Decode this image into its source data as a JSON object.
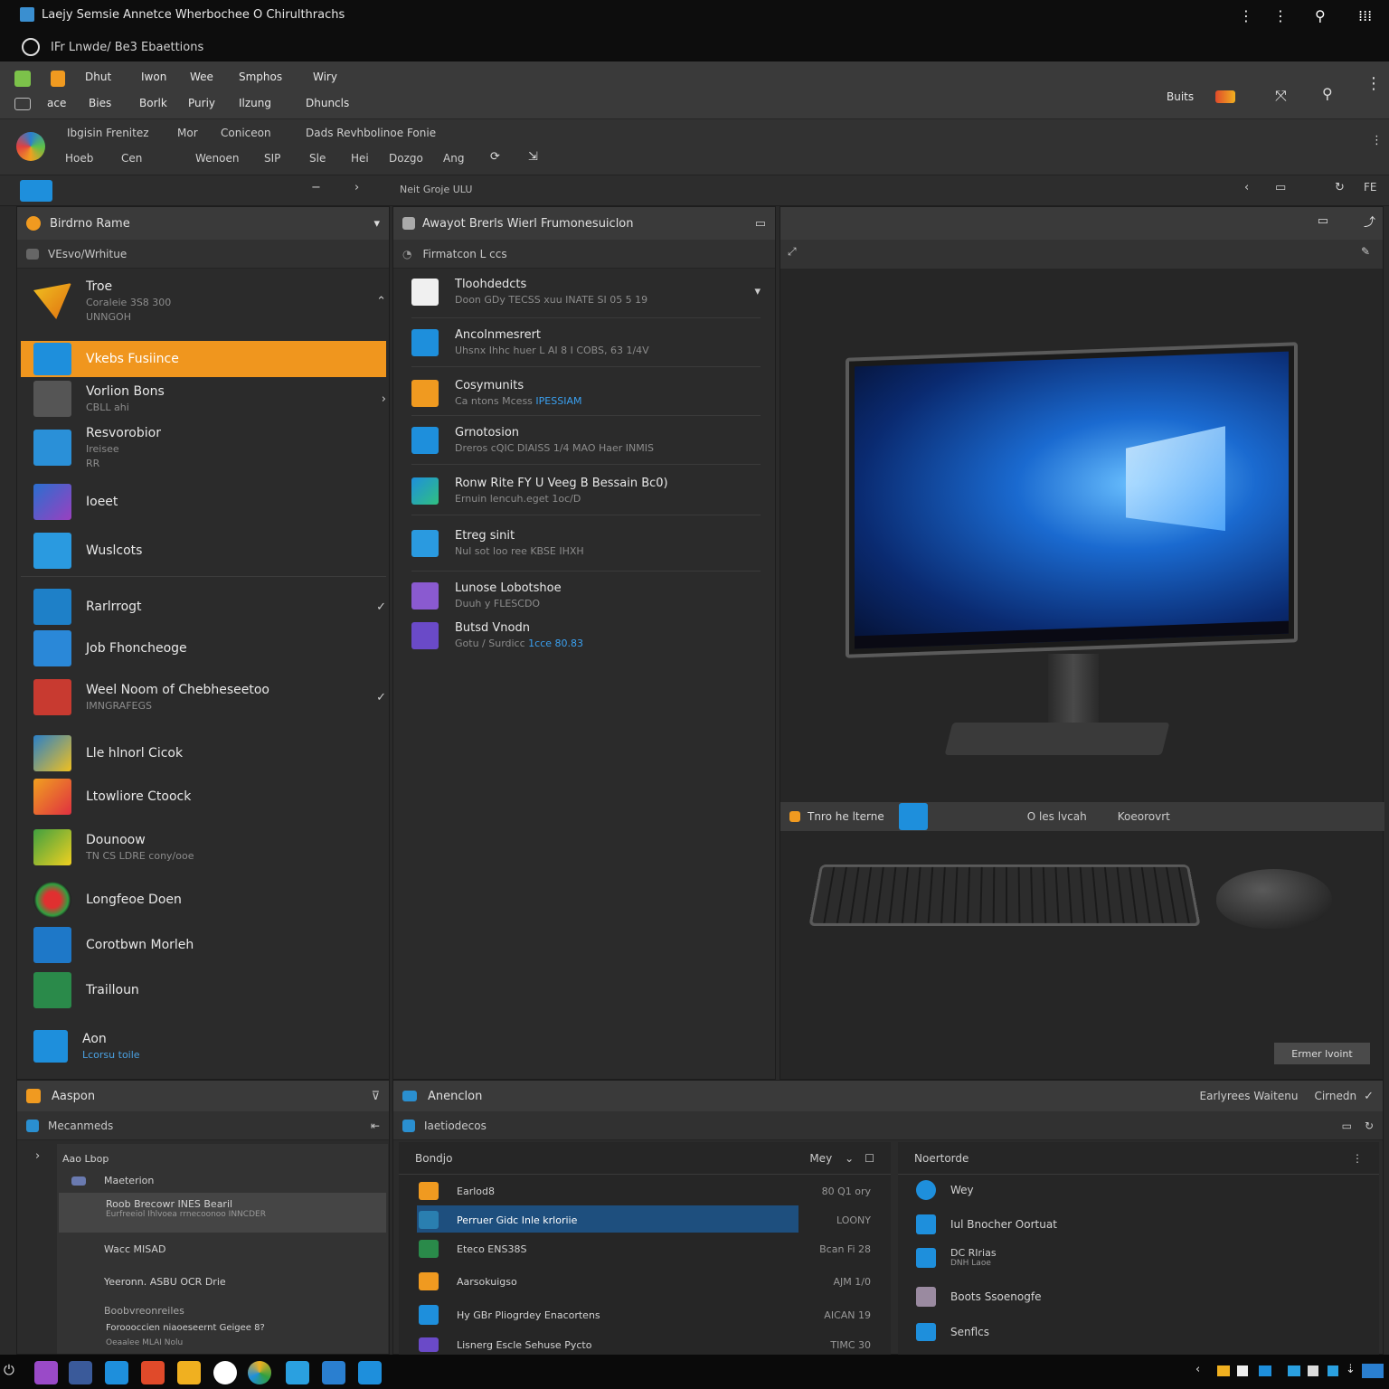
{
  "window": {
    "title": "Laejy Semsie Annetce  Wherbochee  O Chirulthrachs",
    "path": "IFr Lnwde/ Be3 Ebaettions"
  },
  "menu": {
    "row1": [
      "Dhut",
      "Iwon",
      "Wee",
      "Smphos",
      "Wiry"
    ],
    "row2": [
      "ace",
      "Bies",
      "Borlk",
      "Puriy",
      "Ilzung",
      "Dhuncls"
    ],
    "right": "Buits"
  },
  "toolbar": {
    "row1": [
      "Ibgisin Frenitez",
      "Mor",
      "Coniceon",
      "Dads  Revhbolinoe Fonie"
    ],
    "row2": [
      "Hoeb",
      "Cen",
      "Wenoen",
      "SIP",
      "Sle",
      "Hei",
      "Dozgo",
      "Ang"
    ]
  },
  "navbar": {
    "path": "Neit Groje ULU"
  },
  "left_panel": {
    "header": "Birdrno Rame",
    "subheader": "VEsvo/Wrhitue",
    "items": [
      {
        "title": "Troe",
        "sub": "Coraleie 3S8 300",
        "sub2": "UNNGOH"
      },
      {
        "title": "Vkebs Fusiince",
        "sub": ""
      },
      {
        "title": "Vorlion Bons",
        "sub": "CBLL ahi"
      },
      {
        "title": "Resvorobior",
        "sub": "Ireisee",
        "sub2": "RR"
      },
      {
        "title": "Ioeet",
        "sub": ""
      },
      {
        "title": "Wuslcots",
        "sub": ""
      },
      {
        "title": "Rarlrrogt",
        "sub": ""
      },
      {
        "title": "Job Fhoncheoge",
        "sub": ""
      },
      {
        "title": "Weel Noom  of Chebheseetoo",
        "sub": "IMNGRAFEGS"
      },
      {
        "title": "Lle hlnorl Cicok",
        "sub": ""
      },
      {
        "title": "Ltowliore Ctoock",
        "sub": ""
      },
      {
        "title": "Dounoow",
        "sub": "TN CS LDRE cony/ooe"
      },
      {
        "title": "Longfeoe Doen",
        "sub": ""
      },
      {
        "title": "Corotbwn Morleh",
        "sub": ""
      },
      {
        "title": "Trailloun",
        "sub": ""
      },
      {
        "title": "Aon",
        "sub": "Lcorsu toile"
      }
    ]
  },
  "mid_panel": {
    "header": "Awayot Brerls  Wierl Frumonesuiclon",
    "subheader": "Firmatcon L ccs",
    "items": [
      {
        "title": "Tloohdedcts",
        "sub": "Doon GDy TECSS  xuu  INATE SI 05 5 19"
      },
      {
        "title": "Ancolnmesrert",
        "sub": "Uhsnx Ihhc huer L AI 8 I COBS, 63 1/4V"
      },
      {
        "title": "Cosymunits",
        "sub": "Ca ntons  Mcess",
        "accent": "IPESSIAM"
      },
      {
        "title": "Grnotosion",
        "sub": "Dreros  cQIC  DIAISS 1/4 MAO  Haer  INMIS"
      },
      {
        "title": "Ronw Rite FY U  Veeg  B Bessain  Bc0)",
        "sub": "Ernuin  lencuh.eget    1oc/D"
      },
      {
        "title": "Etreg sinit",
        "sub": "Nul sot  loo ree  KBSE  IHXH"
      },
      {
        "title": "Lunose Lobotshoe",
        "sub": "Duuh y  FLESCDO"
      },
      {
        "title": "Butsd Vnodn",
        "sub": "Gotu / Surdicc",
        "accent": "1cce 80.83"
      }
    ]
  },
  "right_panel": {
    "tabs": [
      "Tnro he lterne",
      "O les lvcah",
      "Koeorovrt"
    ],
    "button": "Ermer lvoint"
  },
  "bottom_left": {
    "header": "Aaspon",
    "subheader": "Mecanmeds",
    "tree": [
      "Aao Lbop",
      "Maeterion",
      "Roob  Brecowr INES Bearil",
      "Wacc MISAD",
      "Yeeronn. ASBU  OCR Drie",
      "Boobvreonreiles",
      "Foroooccien niaoeseernt  Geigee 8?"
    ],
    "subline": "Eurfreeiol  Ihlvoea  rrnecoonoo INNCDER",
    "lastline": "Oeaalee  MLAI Nolu"
  },
  "bottom_mid": {
    "header": "Anenclon",
    "header_right": [
      "Earlyrees  Waitenu",
      "Cirnedn"
    ],
    "subheader": "Iaetiodecos",
    "list_header": "Bondjo",
    "list_right": "Mey",
    "rows": [
      {
        "name": "Earlod8",
        "val": "80 Q1 ory"
      },
      {
        "name": "Perruer Gidc Inle krloriie",
        "val": "LOONY"
      },
      {
        "name": "Eteco ENS38S",
        "val": "Bcan Fi 28"
      },
      {
        "name": "Aarsokuigso",
        "val": "AJM 1/0"
      },
      {
        "name": "Hy GBr Pliogrdey  Enacortens",
        "val": "AICAN 19"
      },
      {
        "name": "Lisnerg Escle  Sehuse  Pycto",
        "val": "TIMC 30"
      }
    ],
    "right_header": "Noertorde",
    "right_items": [
      "Wey",
      "Iul Bnocher Oortuat",
      "DC RIrias",
      "Boots Ssoenogfe",
      "Senflcs"
    ],
    "right_item3_sub": "DNH Laoe"
  },
  "colors": {
    "accent_orange": "#f0961e",
    "accent_blue": "#1e8fdc",
    "select_blue": "#1e4f7e"
  }
}
